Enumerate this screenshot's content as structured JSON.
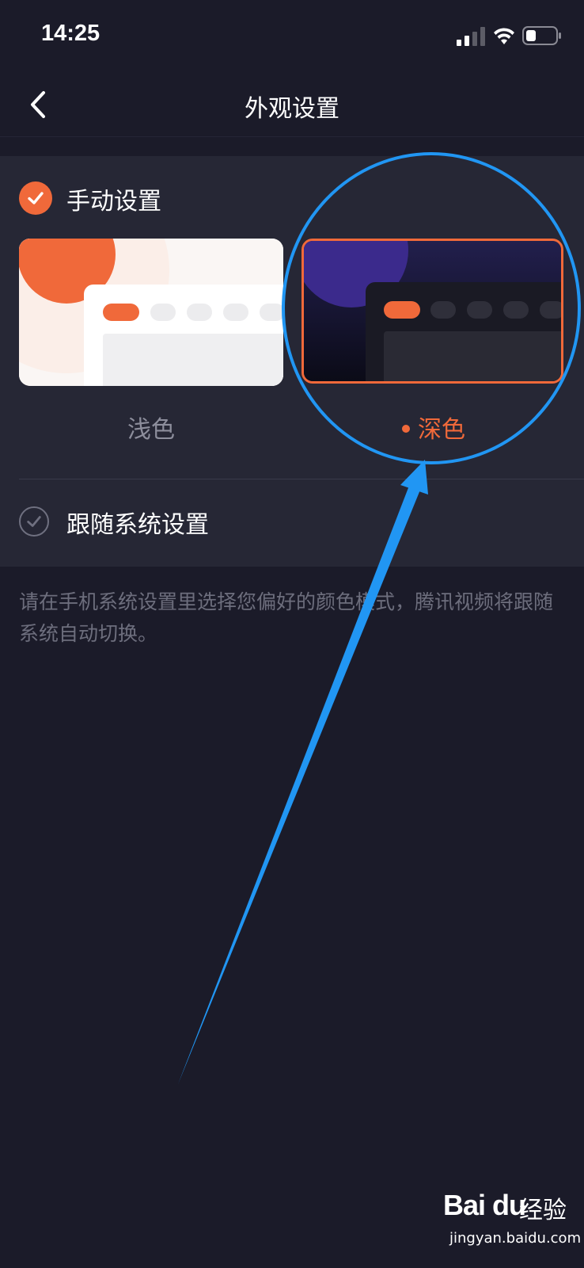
{
  "status_bar": {
    "time": "14:25"
  },
  "nav": {
    "title": "外观设置",
    "back_icon": "chevron-left-icon"
  },
  "appearance": {
    "manual_label": "手动设置",
    "manual_checked": true,
    "options": [
      {
        "id": "light",
        "label": "浅色",
        "selected": false
      },
      {
        "id": "dark",
        "label": "深色",
        "selected": true
      }
    ],
    "follow_label": "跟随系统设置",
    "follow_checked": false
  },
  "hint": "请在手机系统设置里选择您偏好的颜色模式，腾讯视频将跟随系统自动切换。",
  "colors": {
    "accent": "#f0693a",
    "background": "#1b1b29",
    "card": "#262735",
    "annotation": "#2196f3"
  },
  "watermark": {
    "logo": "Bai du",
    "cn": "经验",
    "url": "jingyan.baidu.com"
  }
}
